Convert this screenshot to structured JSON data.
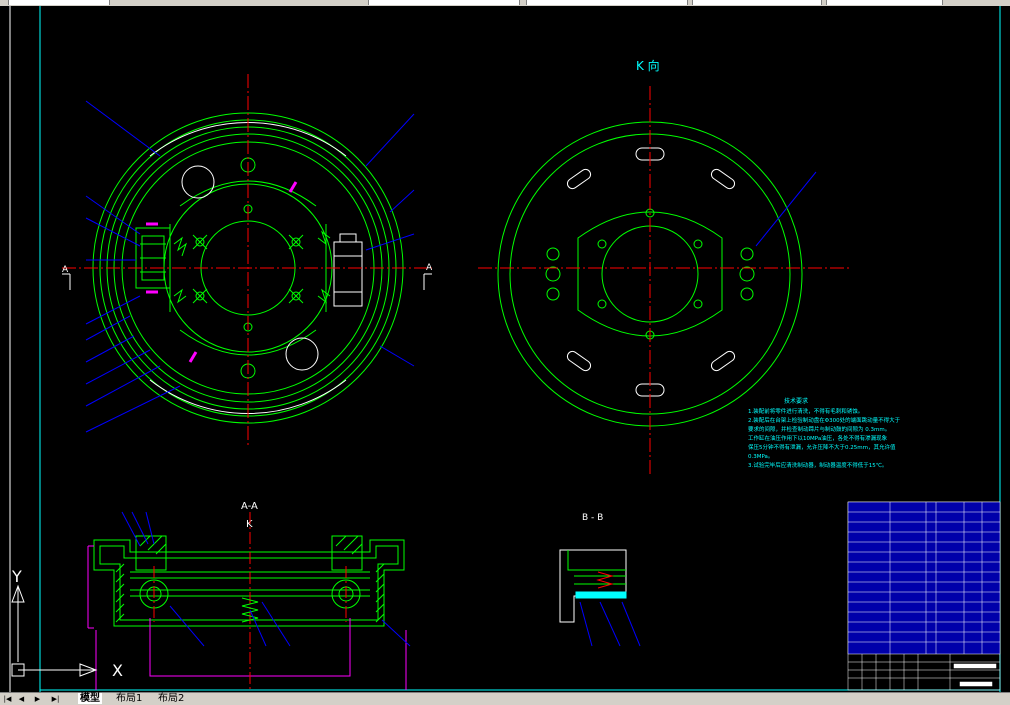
{
  "colors": {
    "background": "#000000",
    "border": "#00ffff",
    "part": "#00ff00",
    "outline": "#ffffff",
    "center": "#ff0000",
    "leader": "#0000ff",
    "accent": "#ff00ff",
    "note": "#00ffff",
    "ui": "#d4d0c8"
  },
  "drawing": {
    "view_k_label": "K 向",
    "section_aa_label": "A-A",
    "section_k_label": "K",
    "section_bb_label": "B - B",
    "cut_label_left": "A",
    "cut_label_right": "A",
    "tech_req": {
      "title": "技术要求",
      "lines": [
        "1.装配前将零件进行清洗，不得有毛刺和锈蚀。",
        "2.装配后在台架上检验制动盘在Φ300处的端面跳动量不得大于",
        "  要求的间隙，并检查制动蹄片与制动鼓的间隙为 0.3mm。",
        "  工作缸在油压作用下以10MPa油压，各处不得有渗漏现象",
        "  保压5分钟不得有泄漏，允许压降不大于0.25mm，其允许值",
        "  0.3MPa。",
        "3.试验完毕后应清洗制动器，制动器温度不得低于15℃。"
      ]
    },
    "ucs": {
      "y_label": "Y",
      "x_label": "X"
    }
  },
  "tabs": {
    "nav_first": "|◀",
    "nav_prev": "◀",
    "nav_next": "▶",
    "nav_last": "▶|",
    "items": [
      "模型",
      "布局1",
      "布局2"
    ]
  }
}
